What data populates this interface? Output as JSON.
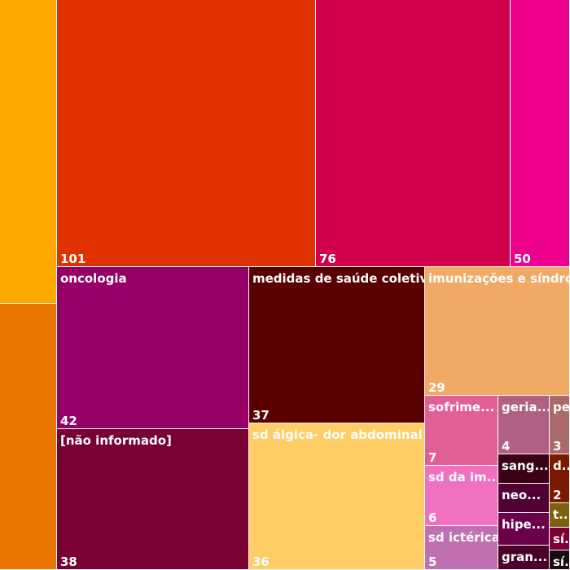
{
  "chart_data": {
    "type": "treemap",
    "tiles": [
      {
        "label": "",
        "value": null,
        "color": "#FFA800"
      },
      {
        "label": "",
        "value": null,
        "color": "#E97400"
      },
      {
        "label": "",
        "value": "101",
        "color": "#E03200"
      },
      {
        "label": "",
        "value": "76",
        "color": "#D1004A"
      },
      {
        "label": "",
        "value": "50",
        "color": "#EC008C"
      },
      {
        "label": "oncologia",
        "value": "42",
        "color": "#960066"
      },
      {
        "label": "medidas de saúde coletiva",
        "value": "37",
        "color": "#5A0000"
      },
      {
        "label": "imunizações e síndrom",
        "value": "29",
        "color": "#F0AA66"
      },
      {
        "label": "[não informado]",
        "value": "38",
        "color": "#780033"
      },
      {
        "label": "sd álgica- dor abdominal",
        "value": "36",
        "color": "#FFCC66"
      },
      {
        "label": "sofrime...",
        "value": "7",
        "color": "#E06096"
      },
      {
        "label": "geria...",
        "value": "4",
        "color": "#B06082"
      },
      {
        "label": "pe...",
        "value": "3",
        "color": "#A86A6A"
      },
      {
        "label": "sd da im...",
        "value": "6",
        "color": "#F070C0"
      },
      {
        "label": "sang...",
        "value": "",
        "color": "#3C0014"
      },
      {
        "label": "d...",
        "value": "2",
        "color": "#7A1A00"
      },
      {
        "label": "neo...",
        "value": "",
        "color": "#500032"
      },
      {
        "label": "t...",
        "value": "",
        "color": "#806010"
      },
      {
        "label": "hipe...",
        "value": "",
        "color": "#6A0048"
      },
      {
        "label": "sí...",
        "value": "",
        "color": "#7A0036"
      },
      {
        "label": "sd ictérica",
        "value": "5",
        "color": "#C070B0"
      },
      {
        "label": "gran...",
        "value": "",
        "color": "#4A0028"
      },
      {
        "label": "sí...",
        "value": "",
        "color": "#1A0A14"
      }
    ]
  }
}
